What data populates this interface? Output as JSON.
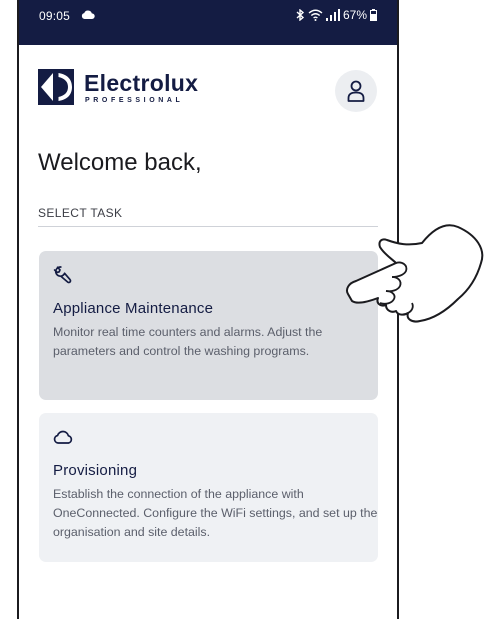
{
  "status_bar": {
    "time": "09:05",
    "battery": "67%",
    "icons": [
      "cloud-icon",
      "bluetooth-icon",
      "wifi-icon",
      "signal-icon",
      "battery-icon"
    ]
  },
  "header": {
    "brand_name": "Electrolux",
    "brand_sub": "PROFESSIONAL",
    "logo_icon": "electrolux-logo",
    "profile_icon": "user-icon"
  },
  "welcome": "Welcome back,",
  "section_label": "SELECT TASK",
  "tasks": [
    {
      "icon": "wrench-icon",
      "title": "Appliance Maintenance",
      "description": "Monitor real time counters and alarms. Adjust the parameters and control the washing programs.",
      "highlighted": true
    },
    {
      "icon": "cloud-icon",
      "title": "Provisioning",
      "description": "Establish the connection of the appliance with OneConnected. Configure the WiFi settings, and set up the organisation and site details.",
      "highlighted": false
    }
  ],
  "colors": {
    "status_bar_bg": "#141c43",
    "brand": "#141c43",
    "highlight_card": "#dcdee2",
    "card": "#eff1f4"
  },
  "overlay": "pointing-hand-icon"
}
